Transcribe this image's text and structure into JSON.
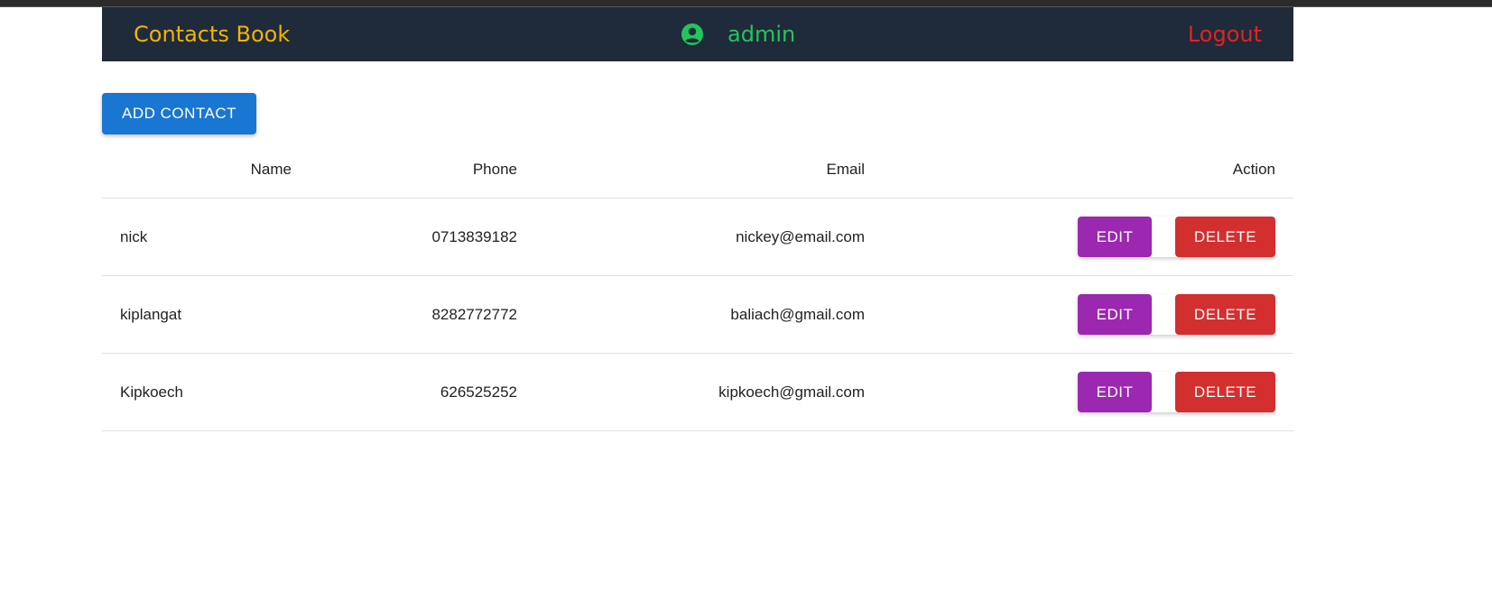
{
  "header": {
    "brand": "Contacts Book",
    "username": "admin",
    "logout_label": "Logout",
    "user_icon": "account-circle-icon"
  },
  "toolbar": {
    "add_contact_label": "ADD CONTACT"
  },
  "table": {
    "columns": [
      "Name",
      "Phone",
      "Email",
      "Action"
    ],
    "rows": [
      {
        "name": "nick",
        "phone": "0713839182",
        "email": "nickey@email.com"
      },
      {
        "name": "kiplangat",
        "phone": "8282772772",
        "email": "baliach@gmail.com"
      },
      {
        "name": "Kipkoech",
        "phone": "626525252",
        "email": "kipkoech@gmail.com"
      }
    ],
    "edit_label": "EDIT",
    "delete_label": "DELETE"
  },
  "colors": {
    "navbar_bg": "#1f2a3a",
    "brand": "#f0b400",
    "username": "#22c55e",
    "logout": "#e02424",
    "primary": "#1976d2",
    "edit": "#9c27b0",
    "delete": "#d32f2f"
  }
}
